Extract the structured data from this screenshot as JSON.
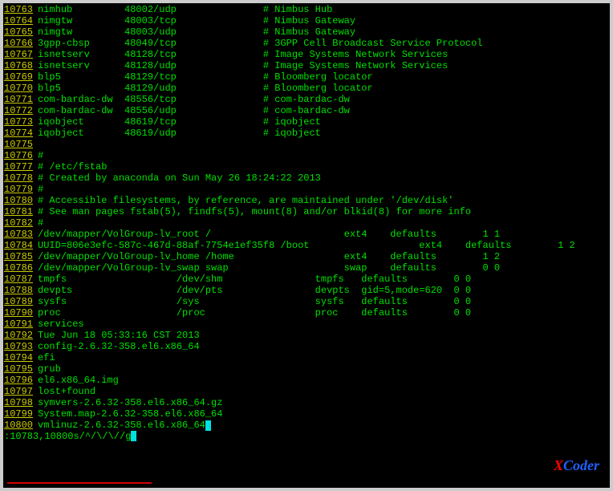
{
  "lines": [
    {
      "n": "10763",
      "t": "nimhub         48002/udp               # Nimbus Hub"
    },
    {
      "n": "10764",
      "t": "nimgtw         48003/tcp               # Nimbus Gateway"
    },
    {
      "n": "10765",
      "t": "nimgtw         48003/udp               # Nimbus Gateway"
    },
    {
      "n": "10766",
      "t": "3gpp-cbsp      48049/tcp               # 3GPP Cell Broadcast Service Protocol"
    },
    {
      "n": "10767",
      "t": "isnetserv      48128/tcp               # Image Systems Network Services"
    },
    {
      "n": "10768",
      "t": "isnetserv      48128/udp               # Image Systems Network Services"
    },
    {
      "n": "10769",
      "t": "blp5           48129/tcp               # Bloomberg locator"
    },
    {
      "n": "10770",
      "t": "blp5           48129/udp               # Bloomberg locator"
    },
    {
      "n": "10771",
      "t": "com-bardac-dw  48556/tcp               # com-bardac-dw"
    },
    {
      "n": "10772",
      "t": "com-bardac-dw  48556/udp               # com-bardac-dw"
    },
    {
      "n": "10773",
      "t": "iqobject       48619/tcp               # iqobject"
    },
    {
      "n": "10774",
      "t": "iqobject       48619/udp               # iqobject"
    },
    {
      "n": "10775",
      "t": ""
    },
    {
      "n": "10776",
      "t": "#"
    },
    {
      "n": "10777",
      "t": "# /etc/fstab"
    },
    {
      "n": "10778",
      "t": "# Created by anaconda on Sun May 26 18:24:22 2013"
    },
    {
      "n": "10779",
      "t": "#"
    },
    {
      "n": "10780",
      "t": "# Accessible filesystems, by reference, are maintained under '/dev/disk'"
    },
    {
      "n": "10781",
      "t": "# See man pages fstab(5), findfs(5), mount(8) and/or blkid(8) for more info"
    },
    {
      "n": "10782",
      "t": "#"
    },
    {
      "n": "10783",
      "t": "/dev/mapper/VolGroup-lv_root /                       ext4    defaults        1 1"
    },
    {
      "n": "10784",
      "t": "UUID=806e3efc-587c-467d-88af-7754e1ef35f8 /boot                   ext4    defaults        1 2"
    },
    {
      "n": "10785",
      "t": "/dev/mapper/VolGroup-lv_home /home                   ext4    defaults        1 2"
    },
    {
      "n": "10786",
      "t": "/dev/mapper/VolGroup-lv_swap swap                    swap    defaults        0 0"
    },
    {
      "n": "10787",
      "t": "tmpfs                   /dev/shm                tmpfs   defaults        0 0"
    },
    {
      "n": "10788",
      "t": "devpts                  /dev/pts                devpts  gid=5,mode=620  0 0"
    },
    {
      "n": "10789",
      "t": "sysfs                   /sys                    sysfs   defaults        0 0"
    },
    {
      "n": "10790",
      "t": "proc                    /proc                   proc    defaults        0 0"
    },
    {
      "n": "10791",
      "t": "services"
    },
    {
      "n": "10792",
      "t": "Tue Jun 18 05:33:16 CST 2013"
    },
    {
      "n": "10793",
      "t": "config-2.6.32-358.el6.x86_64"
    },
    {
      "n": "10794",
      "t": "efi"
    },
    {
      "n": "10795",
      "t": "grub"
    },
    {
      "n": "10796",
      "t": "el6.x86_64.img"
    },
    {
      "n": "10797",
      "t": "lost+found"
    },
    {
      "n": "10798",
      "t": "symvers-2.6.32-358.el6.x86_64.gz"
    },
    {
      "n": "10799",
      "t": "System.map-2.6.32-358.el6.x86_64"
    },
    {
      "n": "10800",
      "t": "vmlinuz-2.6.32-358.el6.x86_64"
    }
  ],
  "cursor_line_index": 37,
  "cursor_col": 30,
  "command": ":10783,10800s/^/\\/\\//g",
  "watermark": {
    "x": "X",
    "coder": "Coder"
  }
}
